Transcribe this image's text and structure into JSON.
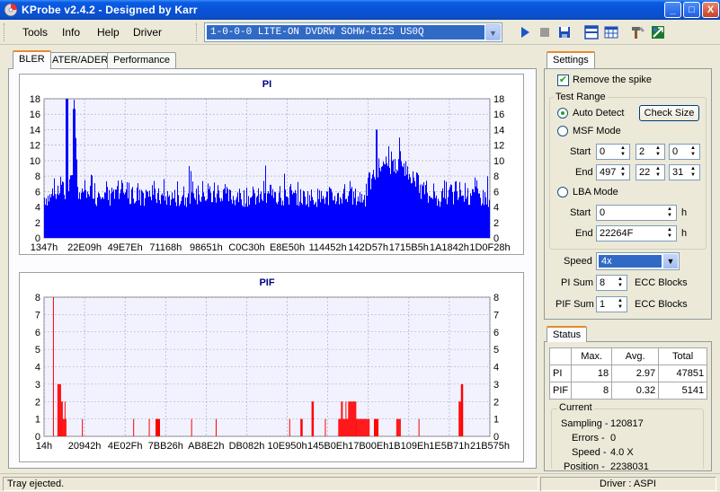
{
  "window": {
    "title": "KProbe v2.4.2 - Designed by Karr",
    "min": "_",
    "max": "□",
    "close": "X"
  },
  "menu": {
    "tools": "Tools",
    "info": "Info",
    "help": "Help",
    "driver": "Driver"
  },
  "drive": {
    "selected": "1-0-0-0 LITE-ON DVDRW SOHW-812S  US0Q"
  },
  "tabs": {
    "bler": "BLER",
    "ater": "ATER/ADER",
    "performance": "Performance"
  },
  "pi_chart": {
    "title": "PI",
    "yticks": [
      "18",
      "16",
      "14",
      "12",
      "10",
      "8",
      "6",
      "4",
      "2",
      "0"
    ],
    "xticks": [
      "1347h",
      "22E09h",
      "49E7Eh",
      "71168h",
      "98651h",
      "C0C30h",
      "E8E50h",
      "114452h",
      "142D57h",
      "1715B5h",
      "1A1842h",
      "1D0F28h"
    ]
  },
  "pif_chart": {
    "title": "PIF",
    "yticks": [
      "8",
      "7",
      "6",
      "5",
      "4",
      "3",
      "2",
      "1",
      "0"
    ],
    "xticks": [
      "14h",
      "20942h",
      "4E02Fh",
      "7BB26h",
      "AB8E2h",
      "DB082h",
      "10E950h",
      "145B0Eh",
      "17B00Eh",
      "1B109Eh",
      "1E5B71h",
      "21B575h"
    ]
  },
  "chart_data": [
    {
      "type": "bar",
      "title": "PI",
      "ylim": [
        0,
        18
      ],
      "x_range_labels": [
        "1347h",
        "1D0F28h"
      ],
      "series": [
        {
          "color": "#0000ff",
          "profile": [
            5,
            5,
            5,
            6,
            5,
            6,
            7,
            6,
            5,
            6,
            8,
            17,
            9,
            6,
            5,
            6,
            5,
            6,
            7,
            6,
            5,
            6,
            6,
            5,
            6,
            5,
            6,
            5,
            6,
            5,
            6,
            5,
            6,
            5,
            6,
            5,
            6,
            5,
            6,
            5,
            6,
            5,
            6,
            5,
            5,
            5,
            5,
            5,
            5,
            5,
            5,
            5,
            5,
            5,
            6,
            5,
            6,
            5,
            6,
            5,
            6,
            5,
            6,
            5,
            6,
            5,
            6,
            5,
            6,
            5,
            6,
            5,
            5,
            5,
            5,
            5,
            5,
            5,
            5,
            5,
            5,
            5,
            5,
            5,
            5,
            5,
            6,
            5,
            6,
            5,
            6,
            5,
            6,
            5,
            6,
            5,
            6,
            5,
            5,
            5,
            5,
            5,
            5,
            5,
            5,
            5,
            5,
            5,
            5,
            5,
            5,
            5,
            5,
            5,
            5,
            5,
            5,
            6,
            5,
            6,
            5,
            5,
            5,
            5,
            5,
            5,
            6,
            7,
            7,
            8,
            8,
            9,
            9,
            9,
            10,
            9,
            10,
            9,
            9,
            10,
            9,
            9,
            8,
            8,
            8,
            7,
            7,
            6,
            6,
            6,
            5,
            5,
            6,
            5,
            5,
            5,
            5,
            6,
            5,
            6,
            5,
            6,
            5,
            6,
            5,
            6,
            5,
            6,
            5,
            6,
            5,
            5,
            5,
            5,
            5
          ]
        }
      ],
      "peaks": [
        {
          "x_frac": 0.05,
          "value": 18
        },
        {
          "x_frac": 0.745,
          "value": 14
        }
      ]
    },
    {
      "type": "bar",
      "title": "PIF",
      "ylim": [
        0,
        8
      ],
      "x_range_labels": [
        "14h",
        "21B575h"
      ],
      "series": [
        {
          "color": "#ff0000",
          "events": [
            {
              "from": 0.02,
              "to": 0.022,
              "value": 8
            },
            {
              "from": 0.03,
              "to": 0.04,
              "value": 3
            },
            {
              "from": 0.04,
              "to": 0.05,
              "value": 2
            },
            {
              "from": 0.085,
              "to": 0.087,
              "value": 1
            },
            {
              "from": 0.2,
              "to": 0.202,
              "value": 1
            },
            {
              "from": 0.235,
              "to": 0.237,
              "value": 1
            },
            {
              "from": 0.25,
              "to": 0.26,
              "value": 1
            },
            {
              "from": 0.33,
              "to": 0.332,
              "value": 1
            },
            {
              "from": 0.385,
              "to": 0.387,
              "value": 1
            },
            {
              "from": 0.55,
              "to": 0.552,
              "value": 1
            },
            {
              "from": 0.575,
              "to": 0.58,
              "value": 1
            },
            {
              "from": 0.6,
              "to": 0.605,
              "value": 2
            },
            {
              "from": 0.63,
              "to": 0.632,
              "value": 1
            },
            {
              "from": 0.66,
              "to": 0.7,
              "value": 2
            },
            {
              "from": 0.7,
              "to": 0.73,
              "value": 1
            },
            {
              "from": 0.74,
              "to": 0.75,
              "value": 1
            },
            {
              "from": 0.79,
              "to": 0.8,
              "value": 1
            },
            {
              "from": 0.84,
              "to": 0.842,
              "value": 1
            },
            {
              "from": 0.93,
              "to": 0.935,
              "value": 2
            },
            {
              "from": 0.935,
              "to": 0.94,
              "value": 3
            }
          ]
        }
      ]
    }
  ],
  "settings": {
    "tab": "Settings",
    "remove_spike": "Remove the spike",
    "test_range": "Test Range",
    "auto_detect": "Auto Detect",
    "check_size": "Check Size",
    "msf_mode": "MSF Mode",
    "start": "Start",
    "end": "End",
    "msf_start": [
      "0",
      "2",
      "0"
    ],
    "msf_end": [
      "497",
      "22",
      "31"
    ],
    "lba_mode": "LBA Mode",
    "lba_start": "0",
    "lba_end": "22264F",
    "h": "h",
    "speed_label": "Speed",
    "speed_value": "4x",
    "pi_sum_label": "PI Sum",
    "pi_sum_value": "8",
    "pif_sum_label": "PIF Sum",
    "pif_sum_value": "1",
    "ecc_blocks": "ECC Blocks"
  },
  "status": {
    "tab": "Status",
    "headers": [
      "",
      "Max.",
      "Avg.",
      "Total"
    ],
    "rows": [
      [
        "PI",
        "18",
        "2.97",
        "47851"
      ],
      [
        "PIF",
        "8",
        "0.32",
        "5141"
      ]
    ],
    "current_title": "Current",
    "sampling_label": "Sampling -",
    "sampling_value": "120817",
    "errors_label": "Errors -",
    "errors_value": "0",
    "speed_label": "Speed -",
    "speed_value": "4.0  X",
    "position_label": "Position -",
    "position_value": "2238031"
  },
  "statusbar": {
    "message": "Tray ejected.",
    "driver": "Driver : ASPI"
  }
}
